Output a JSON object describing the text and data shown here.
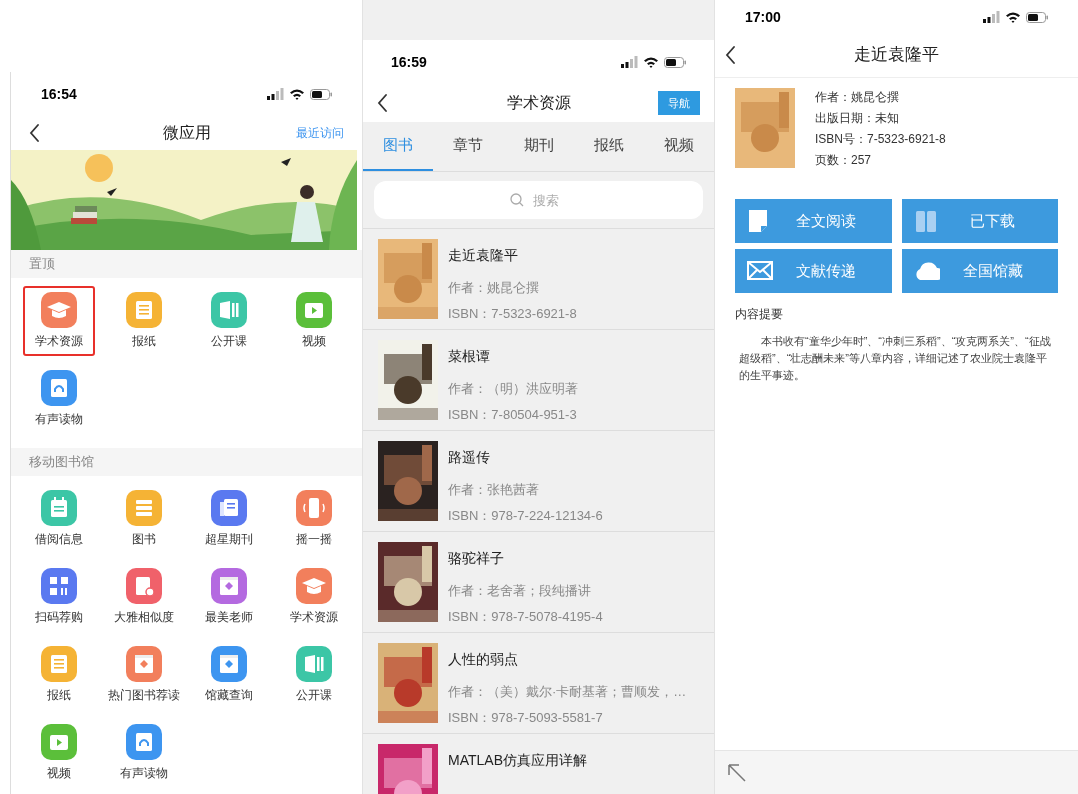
{
  "left_screen": {
    "status_time": "16:54",
    "nav": {
      "title": "微应用",
      "action": "最近访问"
    },
    "sections": [
      {
        "title": "置顶",
        "items": [
          {
            "label": "学术资源",
            "kind": "cap",
            "color": "#f27f5c",
            "highlighted": true
          },
          {
            "label": "报纸",
            "kind": "paper",
            "color": "#f5b335",
            "highlighted": false
          },
          {
            "label": "公开课",
            "kind": "book",
            "color": "#3cc6a6",
            "highlighted": false
          },
          {
            "label": "视频",
            "kind": "video",
            "color": "#5bbf3a",
            "highlighted": false
          },
          {
            "label": "有声读物",
            "kind": "audio",
            "color": "#3d95f0",
            "highlighted": false
          }
        ]
      },
      {
        "title": "移动图书馆",
        "items": [
          {
            "label": "借阅信息",
            "kind": "calendar",
            "color": "#3cc6a6",
            "highlighted": false
          },
          {
            "label": "图书",
            "kind": "list",
            "color": "#f5b335",
            "highlighted": false
          },
          {
            "label": "超星期刊",
            "kind": "magazine",
            "color": "#5a79f0",
            "highlighted": false
          },
          {
            "label": "摇一摇",
            "kind": "phone",
            "color": "#f27f5c",
            "highlighted": false
          },
          {
            "label": "扫码荐购",
            "kind": "qr",
            "color": "#5a79f0",
            "highlighted": false
          },
          {
            "label": "大雅相似度",
            "kind": "clipboard",
            "color": "#f0616a",
            "highlighted": false
          },
          {
            "label": "最美老师",
            "kind": "window",
            "color": "#b46ae0",
            "highlighted": false
          },
          {
            "label": "学术资源",
            "kind": "cap",
            "color": "#f27f5c",
            "highlighted": false
          },
          {
            "label": "报纸",
            "kind": "paper",
            "color": "#f5b335",
            "highlighted": false
          },
          {
            "label": "热门图书荐读",
            "kind": "window",
            "color": "#f27f5c",
            "highlighted": false
          },
          {
            "label": "馆藏查询",
            "kind": "window",
            "color": "#3d95f0",
            "highlighted": false
          },
          {
            "label": "公开课",
            "kind": "book",
            "color": "#3cc6a6",
            "highlighted": false
          },
          {
            "label": "视频",
            "kind": "video",
            "color": "#5bbf3a",
            "highlighted": false
          },
          {
            "label": "有声读物",
            "kind": "audio",
            "color": "#3d95f0",
            "highlighted": false
          }
        ]
      }
    ]
  },
  "middle_screen": {
    "status_time": "16:59",
    "nav": {
      "title": "学术资源",
      "action": "导航"
    },
    "tabs": [
      {
        "label": "图书",
        "selected": true
      },
      {
        "label": "章节",
        "selected": false
      },
      {
        "label": "期刊",
        "selected": false
      },
      {
        "label": "报纸",
        "selected": false
      },
      {
        "label": "视频",
        "selected": false
      }
    ],
    "search": {
      "placeholder": "搜索"
    },
    "books": [
      {
        "title": "走近袁隆平",
        "author": "作者：姚昆仑撰",
        "isbn": "ISBN：7-5323-6921-8"
      },
      {
        "title": "菜根谭",
        "author": "作者：（明）洪应明著",
        "isbn": "ISBN：7-80504-951-3"
      },
      {
        "title": "路遥传",
        "author": "作者：张艳茜著",
        "isbn": "ISBN：978-7-224-12134-6"
      },
      {
        "title": "骆驼祥子",
        "author": "作者：老舍著；段纯播讲",
        "isbn": "ISBN：978-7-5078-4195-4"
      },
      {
        "title": "人性的弱点",
        "author": "作者：（美）戴尔·卡耐基著；曹顺发，…",
        "isbn": "ISBN：978-7-5093-5581-7"
      },
      {
        "title": "MATLAB仿真应用详解"
      }
    ]
  },
  "right_screen": {
    "status_time": "17:00",
    "nav": {
      "title": "走近袁隆平"
    },
    "details": [
      "作者：姚昆仑撰",
      "出版日期：未知",
      "ISBN号：7-5323-6921-8",
      "页数：257"
    ],
    "actions": [
      {
        "label": "全文阅读",
        "kind": "doc"
      },
      {
        "label": "已下载",
        "kind": "books"
      },
      {
        "label": "文献传递",
        "kind": "mail"
      },
      {
        "label": "全国馆藏",
        "kind": "cloud"
      }
    ],
    "summary_title": "内容提要",
    "summary": "本书收有“童华少年时”、“冲刺三系稻”、“攻克两系关”、“征战超级稻”、“壮志酬未来”等八章内容，详细记述了农业院士袁隆平的生平事迹。"
  }
}
